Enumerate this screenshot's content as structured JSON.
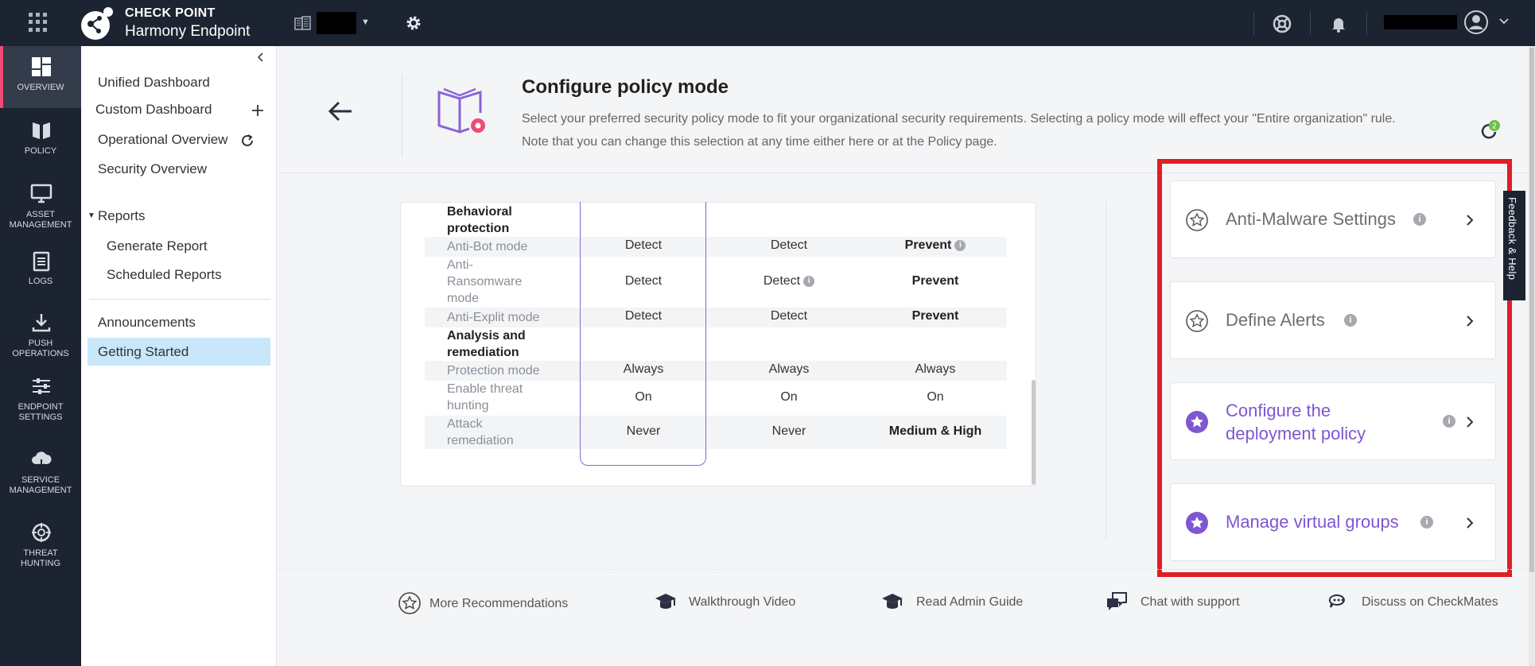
{
  "topbar": {
    "brand_top": "CHECK POINT",
    "brand_bottom": "Harmony Endpoint"
  },
  "leftnav": [
    {
      "label": "OVERVIEW",
      "icon": "dashboard-icon"
    },
    {
      "label": "POLICY",
      "icon": "policy-book-icon"
    },
    {
      "label": "ASSET MANAGEMENT",
      "icon": "monitor-icon"
    },
    {
      "label": "LOGS",
      "icon": "clipboard-icon"
    },
    {
      "label": "PUSH OPERATIONS",
      "icon": "download-icon"
    },
    {
      "label": "ENDPOINT SETTINGS",
      "icon": "sliders-icon"
    },
    {
      "label": "SERVICE MANAGEMENT",
      "icon": "cloud-icon"
    },
    {
      "label": "THREAT HUNTING",
      "icon": "crosshair-icon"
    }
  ],
  "submenu": {
    "unified_dashboard": "Unified Dashboard",
    "custom_dashboard": "Custom Dashboard",
    "operational_overview": "Operational Overview",
    "security_overview": "Security Overview",
    "reports": "Reports",
    "generate_report": "Generate Report",
    "scheduled_reports": "Scheduled Reports",
    "announcements": "Announcements",
    "getting_started": "Getting Started"
  },
  "header": {
    "title": "Configure policy mode",
    "desc_line1": "Select your preferred security policy mode to fit your organizational security requirements. Selecting a policy mode will effect your \"Entire organization\" rule.",
    "desc_line2": "Note that you can change this selection at any time either here or at the Policy page.",
    "sync_badge": "2"
  },
  "table": {
    "section1_l1": "Behavioral",
    "section1_l2": "protection",
    "rows1": [
      {
        "label": "Anti-Bot mode",
        "c1": "Detect",
        "c2": "Detect",
        "c3": "Prevent"
      },
      {
        "label_l1": "Anti-",
        "label_l2": "Ransomware",
        "label_l3": "mode",
        "c1": "Detect",
        "c2": "Detect",
        "c3": "Prevent"
      },
      {
        "label": "Anti-Explit mode",
        "c1": "Detect",
        "c2": "Detect",
        "c3": "Prevent"
      }
    ],
    "section2_l1": "Analysis and",
    "section2_l2": "remediation",
    "rows2": [
      {
        "label": "Protection mode",
        "c1": "Always",
        "c2": "Always",
        "c3": "Always"
      },
      {
        "label_l1": "Enable threat",
        "label_l2": "hunting",
        "c1": "On",
        "c2": "On",
        "c3": "On"
      },
      {
        "label_l1": "Attack",
        "label_l2": "remediation",
        "c1": "Never",
        "c2": "Never",
        "c3": "Medium & High"
      }
    ]
  },
  "cards": [
    {
      "title": "Anti-Malware Settings",
      "style": "grey"
    },
    {
      "title": "Define Alerts",
      "style": "grey"
    },
    {
      "title_l1": "Configure the",
      "title_l2": "deployment policy",
      "style": "purple"
    },
    {
      "title": "Manage virtual groups",
      "style": "purple"
    }
  ],
  "feedback_tab": "Feedback & Help",
  "footer": {
    "more_recommendations": "More Recommendations",
    "walkthrough_video": "Walkthrough Video",
    "read_admin_guide": "Read Admin Guide",
    "chat_with_support": "Chat with support",
    "discuss_checkmates": "Discuss on CheckMates"
  },
  "colors": {
    "topbar_bg": "#1c2331",
    "accent_pink": "#ef4c75",
    "purple": "#7e57d2",
    "highlight_red": "#e01e26",
    "selected_bg": "#c9e7fb"
  }
}
